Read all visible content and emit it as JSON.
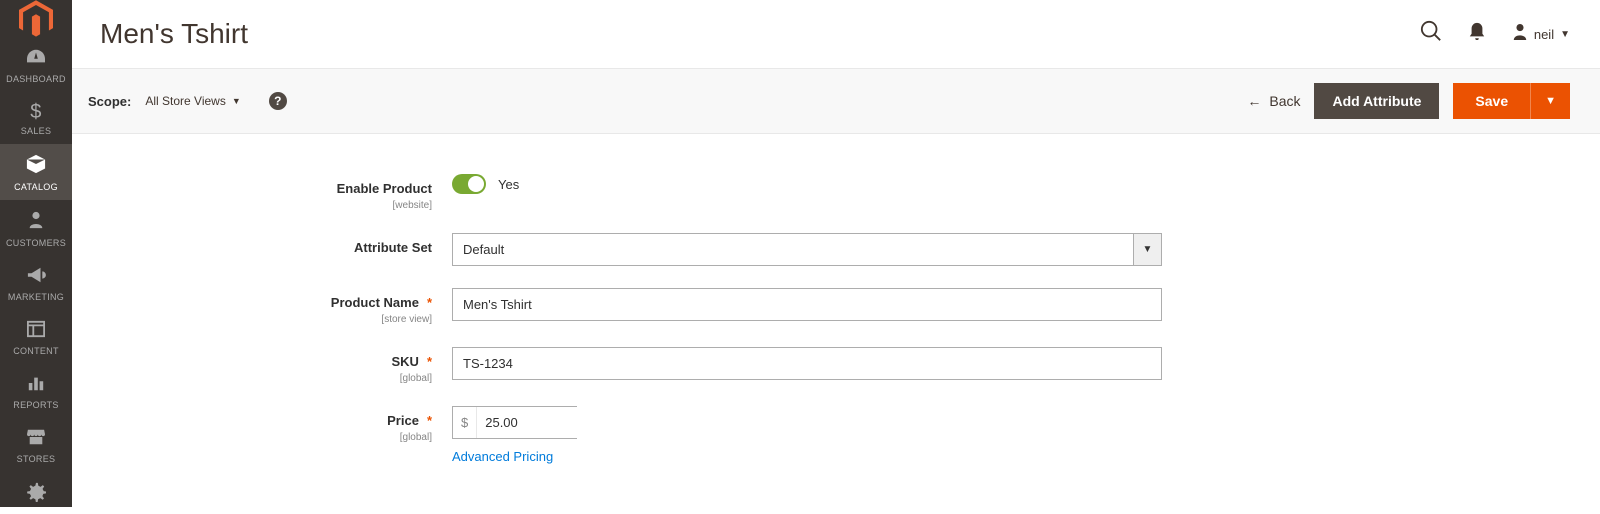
{
  "sidebar": {
    "items": [
      {
        "label": "DASHBOARD"
      },
      {
        "label": "SALES"
      },
      {
        "label": "CATALOG"
      },
      {
        "label": "CUSTOMERS"
      },
      {
        "label": "MARKETING"
      },
      {
        "label": "CONTENT"
      },
      {
        "label": "REPORTS"
      },
      {
        "label": "STORES"
      }
    ]
  },
  "header": {
    "page_title": "Men's Tshirt",
    "user_name": "neil"
  },
  "toolbar": {
    "scope_label": "Scope:",
    "scope_value": "All Store Views",
    "back_label": "Back",
    "add_attribute_label": "Add Attribute",
    "save_label": "Save"
  },
  "form": {
    "enable_product": {
      "label": "Enable Product",
      "scope": "[website]",
      "value_text": "Yes"
    },
    "attribute_set": {
      "label": "Attribute Set",
      "value": "Default"
    },
    "product_name": {
      "label": "Product Name",
      "scope": "[store view]",
      "value": "Men's Tshirt"
    },
    "sku": {
      "label": "SKU",
      "scope": "[global]",
      "value": "TS-1234"
    },
    "price": {
      "label": "Price",
      "scope": "[global]",
      "currency": "$",
      "value": "25.00",
      "advanced_link": "Advanced Pricing"
    }
  }
}
